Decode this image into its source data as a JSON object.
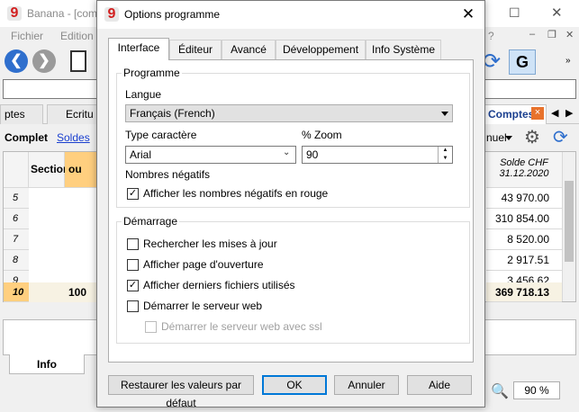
{
  "app": {
    "title": "Banana - [com",
    "window_controls": {
      "minimize": "–",
      "maximize": "☐",
      "close": "✕"
    },
    "menu": [
      "Fichier",
      "Edition",
      "?"
    ],
    "mdi_controls": {
      "minimize": "–",
      "restore": "❐",
      "close": "✕"
    },
    "tabs": {
      "left_partial": "ptes",
      "ecritures_partial": "Ecritu",
      "comptes": "Comptes",
      "comptes_close": "×"
    },
    "subviews": {
      "complet": "Complet",
      "soldes": "Soldes",
      "manuel": "nuel"
    },
    "grid": {
      "col_section": "Section",
      "col_ou": "ou",
      "col_solde_line1": "Solde CHF",
      "col_solde_line2": "31.12.2020",
      "rows": [
        {
          "num": "5",
          "value": "43 970.00"
        },
        {
          "num": "6",
          "value": "310 854.00"
        },
        {
          "num": "7",
          "value": "8 520.00"
        },
        {
          "num": "8",
          "value": "2 917.51"
        },
        {
          "num": "9",
          "value": "3 456.62"
        },
        {
          "num": "10",
          "gr": "100",
          "value": "369 718.13"
        }
      ]
    },
    "bottom_tab": "Info",
    "zoom": "90 %"
  },
  "dialog": {
    "title": "Options programme",
    "close": "✕",
    "tabs": [
      "Interface",
      "Éditeur",
      "Avancé",
      "Développement",
      "Info Système"
    ],
    "active_tab": "Interface",
    "programme": {
      "title": "Programme",
      "langue_label": "Langue",
      "langue_value": "Français (French)",
      "font_label": "Type caractère",
      "font_value": "Arial",
      "zoom_label": "% Zoom",
      "zoom_value": "90",
      "neg_title": "Nombres négatifs",
      "neg_red_label": "Afficher les nombres négatifs en rouge",
      "neg_red_checked": true
    },
    "demarrage": {
      "title": "Démarrage",
      "items": [
        {
          "label": "Rechercher les mises à jour",
          "checked": false,
          "disabled": false
        },
        {
          "label": "Afficher page d'ouverture",
          "checked": false,
          "disabled": false
        },
        {
          "label": "Afficher derniers fichiers utilisés",
          "checked": true,
          "disabled": false
        },
        {
          "label": "Démarrer le serveur web",
          "checked": false,
          "disabled": false
        },
        {
          "label": "Démarrer le serveur web avec ssl",
          "checked": false,
          "disabled": true
        }
      ]
    },
    "buttons": {
      "restore": "Restaurer les valeurs par défaut",
      "ok": "OK",
      "cancel": "Annuler",
      "help": "Aide"
    }
  },
  "icons": {
    "logo": "9",
    "check": "✓",
    "spin_up": "▲",
    "spin_down": "▼",
    "chevron_down": "⌄"
  },
  "colors": {
    "accent": "#0078d7",
    "brand_red": "#d21f1f",
    "nav_blue": "#2f6fcd",
    "highlight_orange": "#ffcf7f"
  }
}
